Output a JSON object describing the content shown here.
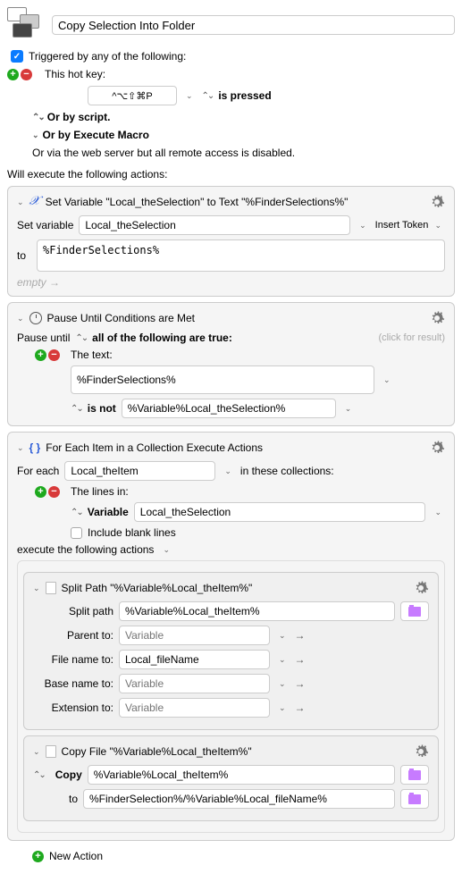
{
  "header": {
    "title": "Copy Selection Into Folder"
  },
  "trigger": {
    "label": "Triggered by any of the following:",
    "hotkey_label": "This hot key:",
    "hotkey_value": "^⌥⇧⌘P",
    "pressed_label": "is pressed",
    "script_label": "Or by script.",
    "execute_macro_label": "Or by Execute Macro",
    "web_server_label": "Or via the web server but all remote access is disabled."
  },
  "actions_label": "Will execute the following actions:",
  "action1": {
    "title": "Set Variable \"Local_theSelection\" to Text \"%FinderSelections%\"",
    "set_var_label": "Set variable",
    "var_name": "Local_theSelection",
    "insert_token": "Insert Token",
    "to_label": "to",
    "to_value": "%FinderSelections%",
    "empty_hint": "empty →"
  },
  "action2": {
    "title": "Pause Until Conditions are Met",
    "pause_label": "Pause until",
    "mode": "all of the following are true:",
    "click_result": "(click for result)",
    "cond_label": "The text:",
    "cond_value": "%FinderSelections%",
    "op": "is not",
    "op_value": "%Variable%Local_theSelection%"
  },
  "action3": {
    "title": "For Each Item in a Collection Execute Actions",
    "foreach_label": "For each",
    "item_var": "Local_theItem",
    "collections_label": "in these collections:",
    "lines_label": "The lines in:",
    "variable_label": "Variable",
    "variable_value": "Local_theSelection",
    "blank_label": "Include blank lines",
    "execute_label": "execute the following actions",
    "sub1": {
      "title": "Split Path \"%Variable%Local_theItem%\"",
      "split_label": "Split path",
      "split_value": "%Variable%Local_theItem%",
      "parent_label": "Parent to:",
      "parent_ph": "Variable",
      "filename_label": "File name to:",
      "filename_value": "Local_fileName",
      "basename_label": "Base name to:",
      "basename_ph": "Variable",
      "ext_label": "Extension to:",
      "ext_ph": "Variable"
    },
    "sub2": {
      "title": "Copy File \"%Variable%Local_theItem%\"",
      "copy_label": "Copy",
      "copy_value": "%Variable%Local_theItem%",
      "to_label": "to",
      "to_value": "%FinderSelection%/%Variable%Local_fileName%"
    }
  },
  "new_action": "New Action"
}
